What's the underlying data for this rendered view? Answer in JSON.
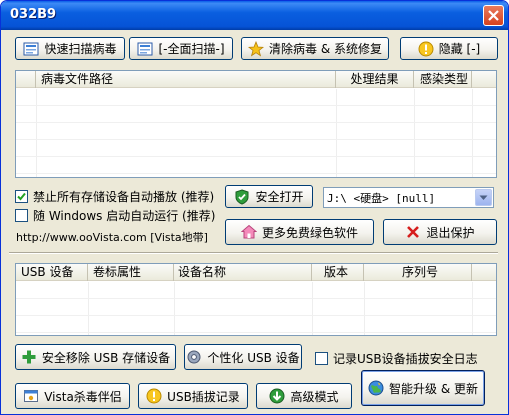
{
  "window": {
    "title": "032B9"
  },
  "toolbar": {
    "quick_scan": "快速扫描病毒",
    "full_scan": "[-全面扫描-]",
    "clean_repair": "清除病毒 & 系统修复",
    "hide": "隐藏 [-]"
  },
  "virus_list": {
    "columns": [
      "病毒文件路径",
      "处理结果",
      "感染类型"
    ]
  },
  "options": {
    "disable_autoplay": "禁止所有存储设备自动播放 (推荐)",
    "disable_autoplay_checked": true,
    "run_at_startup": "随  Windows 启动自动运行 (推荐)",
    "run_at_startup_checked": false,
    "website": "http://www.ooVista.com [Vista地带]"
  },
  "actions": {
    "safe_open": "安全打开",
    "drive_selected": "J:\\ <硬盘> [null]",
    "more_software": "更多免费绿色软件",
    "exit_protect": "退出保护"
  },
  "usb_list": {
    "columns": [
      "USB 设备",
      "卷标属性",
      "设备名称",
      "版本",
      "序列号"
    ]
  },
  "usb_actions": {
    "safe_remove": "安全移除 USB 存储设备",
    "personalize": "个性化 USB 设备",
    "log_label": "记录USB设备插拔安全日志",
    "log_checked": false
  },
  "footer": {
    "vista_partner": "Vista杀毒伴侣",
    "usb_log": "USB插拔记录",
    "advanced": "高级模式",
    "upgrade": "智能升级 & 更新"
  },
  "colors": {
    "titlebar": "#0653d6",
    "window_bg": "#ece9d8",
    "close": "#d6411e"
  }
}
